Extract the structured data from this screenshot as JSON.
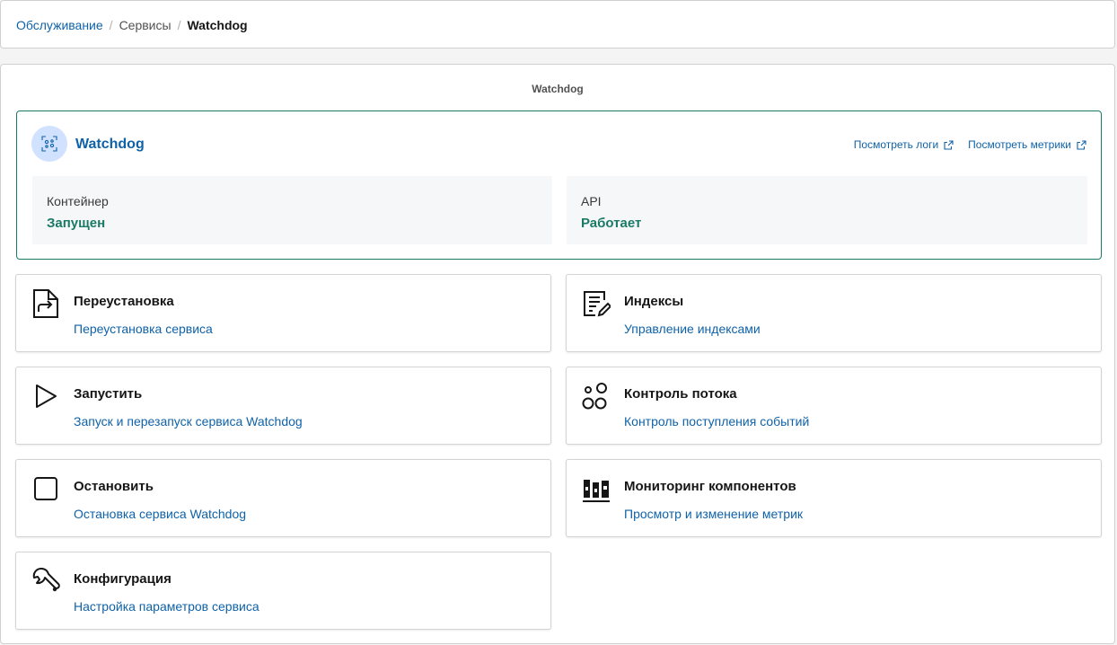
{
  "breadcrumb": {
    "items": [
      "Обслуживание",
      "Сервисы"
    ],
    "current": "Watchdog"
  },
  "page": {
    "title": "Watchdog"
  },
  "service": {
    "name": "Watchdog",
    "icon": "service-icon",
    "links": {
      "logs": "Посмотреть логи",
      "metrics": "Посмотреть метрики"
    },
    "stats": [
      {
        "label": "Контейнер",
        "value": "Запущен"
      },
      {
        "label": "API",
        "value": "Работает"
      }
    ],
    "status_color": "#1b7a66"
  },
  "actions": [
    {
      "icon": "reinstall-icon",
      "title": "Переустановка",
      "link": "Переустановка сервиса"
    },
    {
      "icon": "indexes-icon",
      "title": "Индексы",
      "link": "Управление индексами"
    },
    {
      "icon": "play-icon",
      "title": "Запустить",
      "link": "Запуск и перезапуск сервиса Watchdog"
    },
    {
      "icon": "flow-control-icon",
      "title": "Контроль потока",
      "link": "Контроль поступления событий"
    },
    {
      "icon": "stop-icon",
      "title": "Остановить",
      "link": "Остановка сервиса Watchdog"
    },
    {
      "icon": "monitoring-icon",
      "title": "Мониторинг компонентов",
      "link": "Просмотр и изменение метрик"
    },
    {
      "icon": "wrench-icon",
      "title": "Конфигурация",
      "link": "Настройка параметров сервиса"
    }
  ],
  "colors": {
    "link": "#0f62a8",
    "accent": "#1b7a66"
  }
}
